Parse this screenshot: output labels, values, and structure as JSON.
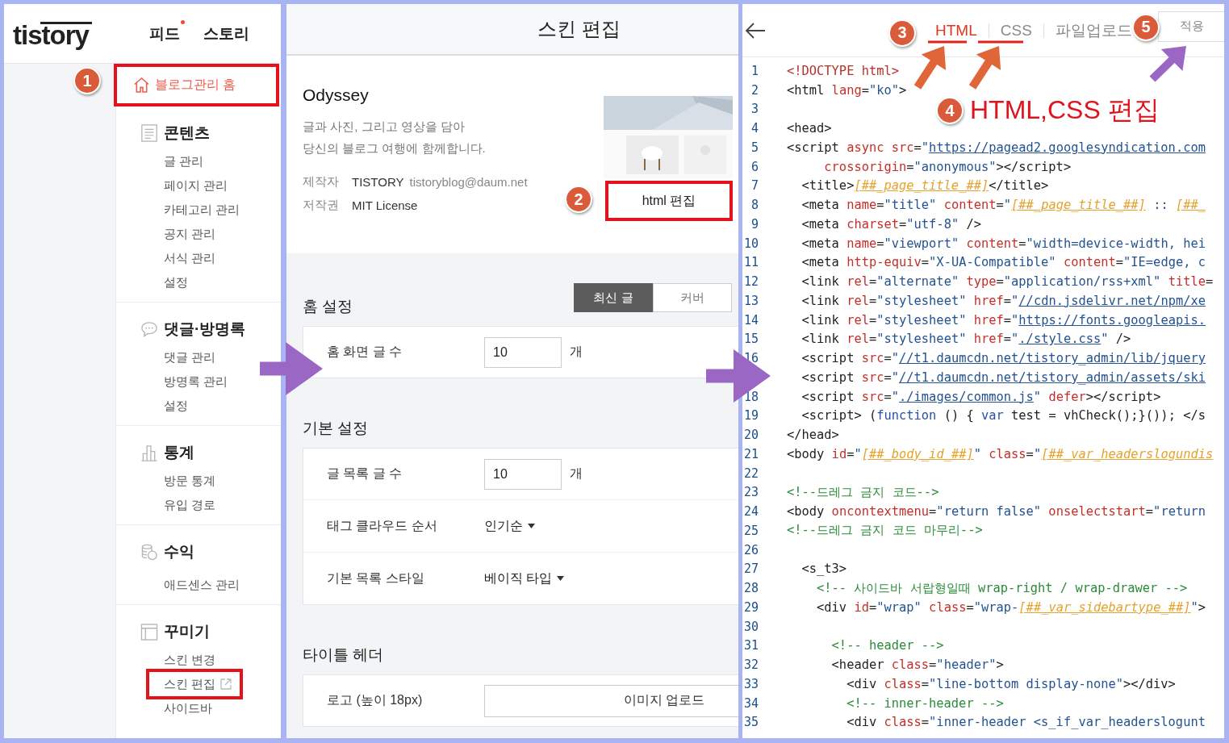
{
  "blog_admin": {
    "logo": "tistory",
    "nav": [
      {
        "label": "피드",
        "badge": true
      },
      {
        "label": "스토리",
        "badge": false
      }
    ],
    "home": {
      "label": "블로그관리 홈",
      "selected": true,
      "highlighted": true,
      "marker": "1"
    },
    "sections": [
      {
        "title": "콘텐츠",
        "items": [
          {
            "label": "글 관리",
            "highlighted": false,
            "external": false
          },
          {
            "label": "페이지 관리",
            "highlighted": false,
            "external": false
          },
          {
            "label": "카테고리 관리",
            "highlighted": false,
            "external": false
          },
          {
            "label": "공지 관리",
            "highlighted": false,
            "external": false
          },
          {
            "label": "서식 관리",
            "highlighted": false,
            "external": false
          },
          {
            "label": "설정",
            "highlighted": false,
            "external": false
          }
        ]
      },
      {
        "title": "댓글·방명록",
        "items": [
          {
            "label": "댓글 관리",
            "highlighted": false,
            "external": false
          },
          {
            "label": "방명록 관리",
            "highlighted": false,
            "external": false
          },
          {
            "label": "설정",
            "highlighted": false,
            "external": false
          }
        ]
      },
      {
        "title": "통계",
        "items": [
          {
            "label": "방문 통계",
            "highlighted": false,
            "external": false
          },
          {
            "label": "유입 경로",
            "highlighted": false,
            "external": false
          }
        ]
      },
      {
        "title": "수익",
        "items": [
          {
            "label": "애드센스 관리",
            "highlighted": false,
            "external": false
          }
        ]
      },
      {
        "title": "꾸미기",
        "items": [
          {
            "label": "스킨 변경",
            "highlighted": false,
            "external": false
          },
          {
            "label": "스킨 편집",
            "highlighted": true,
            "external": true
          },
          {
            "label": "사이드바",
            "highlighted": false,
            "external": false
          }
        ]
      }
    ]
  },
  "skin_editor": {
    "title": "스킨 편집",
    "skin": {
      "name": "Odyssey",
      "description": [
        "글과 사진, 그리고 영상을 담아",
        "당신의 블로그 여행에 함께합니다."
      ],
      "author_label": "제작자",
      "author": "TISTORY",
      "email": "tistoryblog@daum.net",
      "license_label": "저작권",
      "license": "MIT License",
      "preview": {
        "kind": "picture"
      }
    },
    "edit_button": {
      "label": "html 편집",
      "highlighted": true,
      "marker": "2"
    },
    "sections": [
      {
        "title": "홈 설정",
        "toggle": [
          {
            "label": "최신 글",
            "selected": true
          },
          {
            "label": "커버",
            "selected": false
          }
        ],
        "rows": [
          {
            "kind": "number",
            "label": "홈 화면 글 수",
            "value": "10",
            "unit": "개"
          }
        ]
      },
      {
        "title": "기본 설정",
        "rows": [
          {
            "kind": "number",
            "label": "글 목록 글 수",
            "value": "10",
            "unit": "개"
          },
          {
            "kind": "select",
            "label": "태그 클라우드 순서",
            "value": "인기순"
          },
          {
            "kind": "select",
            "label": "기본 목록 스타일",
            "value": "베이직 타입"
          }
        ]
      },
      {
        "title": "타이틀 헤더",
        "rows": [
          {
            "kind": "upload",
            "label": "로고 (높이 18px)",
            "button": "이미지 업로드"
          }
        ]
      }
    ]
  },
  "code_editor": {
    "tab_marker": "3",
    "tabs": [
      {
        "label": "HTML",
        "selected": true
      },
      {
        "label": "CSS",
        "selected": false
      },
      {
        "label": "파일업로드",
        "selected": false
      }
    ],
    "apply_button": {
      "label": "적용",
      "marker": "5"
    },
    "callout": {
      "marker": "4",
      "text": "HTML,CSS 편집"
    },
    "lines": [
      {
        "n": "1",
        "code": [
          {
            "kind": "doctype",
            "text": "<!DOCTYPE html>"
          }
        ]
      },
      {
        "n": "2",
        "code": [
          {
            "kind": "tag",
            "text": "<html"
          },
          {
            "kind": "attr",
            "text": " lang"
          },
          {
            "kind": "tag",
            "text": "="
          },
          {
            "kind": "string",
            "text": "\"ko\""
          },
          {
            "kind": "tag",
            "text": ">"
          }
        ]
      },
      {
        "n": "3"
      },
      {
        "n": "4",
        "code": [
          {
            "kind": "tag",
            "text": "<head>"
          }
        ]
      },
      {
        "n": "5",
        "code": [
          {
            "kind": "tag",
            "text": "<script"
          },
          {
            "kind": "attr",
            "text": " async src"
          },
          {
            "kind": "tag",
            "text": "="
          },
          {
            "kind": "string",
            "text": "\""
          },
          {
            "kind": "url",
            "text": "https://pagead2.googlesyndication.com"
          }
        ]
      },
      {
        "n": "6",
        "code": [
          {
            "kind": "attr",
            "text": "     crossorigin"
          },
          {
            "kind": "tag",
            "text": "="
          },
          {
            "kind": "string",
            "text": "\"anonymous\""
          },
          {
            "kind": "tag",
            "text": "></script>"
          }
        ]
      },
      {
        "n": "7",
        "code": [
          {
            "kind": "tag",
            "text": "  <title>"
          },
          {
            "kind": "var",
            "text": "[##_page_title_##]"
          },
          {
            "kind": "tag",
            "text": "</title>"
          }
        ]
      },
      {
        "n": "8",
        "code": [
          {
            "kind": "tag",
            "text": "  <meta"
          },
          {
            "kind": "attr",
            "text": " name"
          },
          {
            "kind": "tag",
            "text": "="
          },
          {
            "kind": "string",
            "text": "\"title\""
          },
          {
            "kind": "attr",
            "text": " content"
          },
          {
            "kind": "tag",
            "text": "="
          },
          {
            "kind": "string",
            "text": "\""
          },
          {
            "kind": "var",
            "text": "[##_page_title_##]"
          },
          {
            "kind": "string",
            "text": " :: "
          },
          {
            "kind": "var",
            "text": "[##_"
          }
        ]
      },
      {
        "n": "9",
        "code": [
          {
            "kind": "tag",
            "text": "  <meta"
          },
          {
            "kind": "attr",
            "text": " charset"
          },
          {
            "kind": "tag",
            "text": "="
          },
          {
            "kind": "string",
            "text": "\"utf-8\""
          },
          {
            "kind": "tag",
            "text": " />"
          }
        ]
      },
      {
        "n": "10",
        "code": [
          {
            "kind": "tag",
            "text": "  <meta"
          },
          {
            "kind": "attr",
            "text": " name"
          },
          {
            "kind": "tag",
            "text": "="
          },
          {
            "kind": "string",
            "text": "\"viewport\""
          },
          {
            "kind": "attr",
            "text": " content"
          },
          {
            "kind": "tag",
            "text": "="
          },
          {
            "kind": "string",
            "text": "\"width=device-width, hei"
          }
        ]
      },
      {
        "n": "11",
        "code": [
          {
            "kind": "tag",
            "text": "  <meta"
          },
          {
            "kind": "attr",
            "text": " http-equiv"
          },
          {
            "kind": "tag",
            "text": "="
          },
          {
            "kind": "string",
            "text": "\"X-UA-Compatible\""
          },
          {
            "kind": "attr",
            "text": " content"
          },
          {
            "kind": "tag",
            "text": "="
          },
          {
            "kind": "string",
            "text": "\"IE=edge, c"
          }
        ]
      },
      {
        "n": "12",
        "code": [
          {
            "kind": "tag",
            "text": "  <link"
          },
          {
            "kind": "attr",
            "text": " rel"
          },
          {
            "kind": "tag",
            "text": "="
          },
          {
            "kind": "string",
            "text": "\"alternate\""
          },
          {
            "kind": "attr",
            "text": " type"
          },
          {
            "kind": "tag",
            "text": "="
          },
          {
            "kind": "string",
            "text": "\"application/rss+xml\""
          },
          {
            "kind": "attr",
            "text": " title"
          },
          {
            "kind": "tag",
            "text": "="
          }
        ]
      },
      {
        "n": "13",
        "code": [
          {
            "kind": "tag",
            "text": "  <link"
          },
          {
            "kind": "attr",
            "text": " rel"
          },
          {
            "kind": "tag",
            "text": "="
          },
          {
            "kind": "string",
            "text": "\"stylesheet\""
          },
          {
            "kind": "attr",
            "text": " href"
          },
          {
            "kind": "tag",
            "text": "="
          },
          {
            "kind": "string",
            "text": "\""
          },
          {
            "kind": "url",
            "text": "//cdn.jsdelivr.net/npm/xe"
          }
        ]
      },
      {
        "n": "14",
        "code": [
          {
            "kind": "tag",
            "text": "  <link"
          },
          {
            "kind": "attr",
            "text": " rel"
          },
          {
            "kind": "tag",
            "text": "="
          },
          {
            "kind": "string",
            "text": "\"stylesheet\""
          },
          {
            "kind": "attr",
            "text": " href"
          },
          {
            "kind": "tag",
            "text": "="
          },
          {
            "kind": "string",
            "text": "\""
          },
          {
            "kind": "url",
            "text": "https://fonts.googleapis."
          }
        ]
      },
      {
        "n": "15",
        "code": [
          {
            "kind": "tag",
            "text": "  <link"
          },
          {
            "kind": "attr",
            "text": " rel"
          },
          {
            "kind": "tag",
            "text": "="
          },
          {
            "kind": "string",
            "text": "\"stylesheet\""
          },
          {
            "kind": "attr",
            "text": " href"
          },
          {
            "kind": "tag",
            "text": "="
          },
          {
            "kind": "string",
            "text": "\""
          },
          {
            "kind": "url",
            "text": "./style.css"
          },
          {
            "kind": "string",
            "text": "\""
          },
          {
            "kind": "tag",
            "text": " />"
          }
        ]
      },
      {
        "n": "16",
        "code": [
          {
            "kind": "tag",
            "text": "  <script"
          },
          {
            "kind": "attr",
            "text": " src"
          },
          {
            "kind": "tag",
            "text": "="
          },
          {
            "kind": "string",
            "text": "\""
          },
          {
            "kind": "url",
            "text": "//t1.daumcdn.net/tistory_admin/lib/jquery"
          }
        ]
      },
      {
        "code": [
          {
            "kind": "tag",
            "text": "  <script"
          },
          {
            "kind": "attr",
            "text": " src"
          },
          {
            "kind": "tag",
            "text": "="
          },
          {
            "kind": "string",
            "text": "\""
          },
          {
            "kind": "url",
            "text": "//t1.daumcdn.net/tistory_admin/assets/ski"
          }
        ]
      },
      {
        "n": "18",
        "code": [
          {
            "kind": "tag",
            "text": "  <script"
          },
          {
            "kind": "attr",
            "text": " src"
          },
          {
            "kind": "tag",
            "text": "="
          },
          {
            "kind": "string",
            "text": "\""
          },
          {
            "kind": "url",
            "text": "./images/common.js"
          },
          {
            "kind": "string",
            "text": "\""
          },
          {
            "kind": "attr",
            "text": " defer"
          },
          {
            "kind": "tag",
            "text": "></script>"
          }
        ]
      },
      {
        "n": "19",
        "code": [
          {
            "kind": "tag",
            "text": "  <script>"
          },
          {
            "kind": "plain",
            "text": " ("
          },
          {
            "kind": "keyword",
            "text": "function"
          },
          {
            "kind": "plain",
            "text": " () { "
          },
          {
            "kind": "keyword",
            "text": "var"
          },
          {
            "kind": "plain",
            "text": " test = vhCheck();}()); </s"
          }
        ]
      },
      {
        "n": "20",
        "code": [
          {
            "kind": "tag",
            "text": "</head>"
          }
        ]
      },
      {
        "n": "21",
        "code": [
          {
            "kind": "tag",
            "text": "<body"
          },
          {
            "kind": "attr",
            "text": " id"
          },
          {
            "kind": "tag",
            "text": "="
          },
          {
            "kind": "string",
            "text": "\""
          },
          {
            "kind": "var",
            "text": "[##_body_id_##]"
          },
          {
            "kind": "string",
            "text": "\""
          },
          {
            "kind": "attr",
            "text": " class"
          },
          {
            "kind": "tag",
            "text": "="
          },
          {
            "kind": "string",
            "text": "\""
          },
          {
            "kind": "var",
            "text": "[##_var_headerslogundis"
          }
        ]
      },
      {
        "n": "22"
      },
      {
        "n": "23",
        "code": [
          {
            "kind": "comment",
            "text": "<!--드레그 금지 코드-->"
          }
        ]
      },
      {
        "n": "24",
        "code": [
          {
            "kind": "tag",
            "text": "<body"
          },
          {
            "kind": "attr",
            "text": " oncontextmenu"
          },
          {
            "kind": "tag",
            "text": "="
          },
          {
            "kind": "string",
            "text": "\"return false\""
          },
          {
            "kind": "attr",
            "text": " onselectstart"
          },
          {
            "kind": "tag",
            "text": "="
          },
          {
            "kind": "string",
            "text": "\"return"
          }
        ]
      },
      {
        "n": "25",
        "code": [
          {
            "kind": "comment",
            "text": "<!--드레그 금지 코드 마무리-->"
          }
        ]
      },
      {
        "n": "26"
      },
      {
        "n": "27",
        "code": [
          {
            "kind": "tag",
            "text": "  <s_t3>"
          }
        ]
      },
      {
        "n": "28",
        "code": [
          {
            "kind": "comment",
            "text": "    <!-- 사이드바 서랍형일때 wrap-right / wrap-drawer -->"
          }
        ]
      },
      {
        "n": "29",
        "code": [
          {
            "kind": "tag",
            "text": "    <div"
          },
          {
            "kind": "attr",
            "text": " id"
          },
          {
            "kind": "tag",
            "text": "="
          },
          {
            "kind": "string",
            "text": "\"wrap\""
          },
          {
            "kind": "attr",
            "text": " class"
          },
          {
            "kind": "tag",
            "text": "="
          },
          {
            "kind": "string",
            "text": "\"wrap-"
          },
          {
            "kind": "var",
            "text": "[##_var_sidebartype_##]"
          },
          {
            "kind": "string",
            "text": "\""
          },
          {
            "kind": "tag",
            "text": ">"
          }
        ]
      },
      {
        "n": "30"
      },
      {
        "n": "31",
        "code": [
          {
            "kind": "comment",
            "text": "      <!-- header -->"
          }
        ]
      },
      {
        "n": "32",
        "code": [
          {
            "kind": "tag",
            "text": "      <header"
          },
          {
            "kind": "attr",
            "text": " class"
          },
          {
            "kind": "tag",
            "text": "="
          },
          {
            "kind": "string",
            "text": "\"header\""
          },
          {
            "kind": "tag",
            "text": ">"
          }
        ]
      },
      {
        "n": "33",
        "code": [
          {
            "kind": "tag",
            "text": "        <div"
          },
          {
            "kind": "attr",
            "text": " class"
          },
          {
            "kind": "tag",
            "text": "="
          },
          {
            "kind": "string",
            "text": "\"line-bottom display-none\""
          },
          {
            "kind": "tag",
            "text": "></div>"
          }
        ]
      },
      {
        "n": "34",
        "code": [
          {
            "kind": "comment",
            "text": "        <!-- inner-header -->"
          }
        ]
      },
      {
        "n": "35",
        "code": [
          {
            "kind": "tag",
            "text": "        <div"
          },
          {
            "kind": "attr",
            "text": " class"
          },
          {
            "kind": "tag",
            "text": "="
          },
          {
            "kind": "string",
            "text": "\"inner-header <s_if_var_headerslogunt"
          }
        ]
      }
    ]
  }
}
